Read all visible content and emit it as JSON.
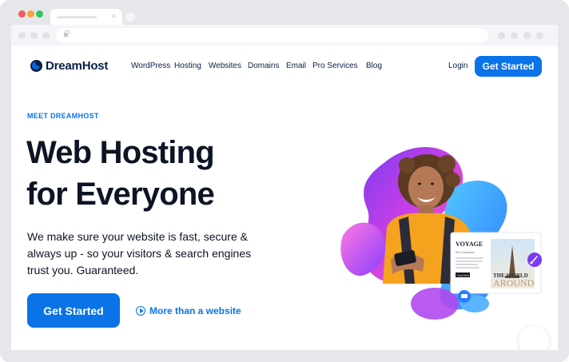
{
  "browser": {
    "tab_close": "×"
  },
  "logo": {
    "text": "DreamHost"
  },
  "nav": {
    "items": [
      "WordPress",
      "Hosting",
      "Websites",
      "Domains",
      "Email",
      "Pro Services",
      "Blog"
    ],
    "login": "Login",
    "cta": "Get Started"
  },
  "hero": {
    "eyebrow": "MEET DREAMHOST",
    "title_line1": "Web Hosting",
    "title_line2": "for Everyone",
    "subtitle": "We make sure your website is fast, secure & always up - so your visitors & search engines trust you. Guaranteed.",
    "cta": "Get Started",
    "secondary": "More than a website",
    "card_title": "VOYAGE",
    "card_sub": "Rich Getaways",
    "card_button": "Know More",
    "card_img_text1": "THE WORLD",
    "card_img_text2": "AROUND"
  },
  "colors": {
    "brand_blue": "#0b73e8",
    "brand_navy": "#0b1f44",
    "frame": "#e6e7eb"
  },
  "icons": [
    "lock-icon",
    "play-circle-icon",
    "logo-moon-icon",
    "chat-icon",
    "brush-icon"
  ]
}
